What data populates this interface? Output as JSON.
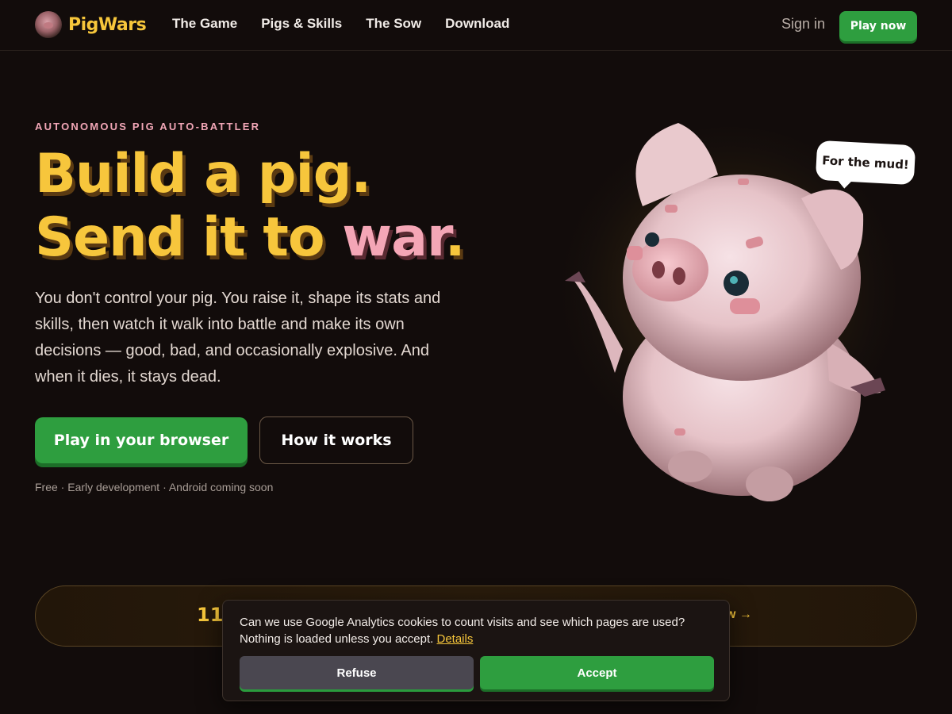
{
  "header": {
    "logo_text": "PigWars",
    "nav": [
      "The Game",
      "Pigs & Skills",
      "The Sow",
      "Download"
    ],
    "signin_label": "Sign in",
    "play_now_label": "Play now"
  },
  "hero": {
    "eyebrow": "AUTONOMOUS PIG AUTO-BATTLER",
    "headline_line1": "Build a pig.",
    "headline_line2_a": "Send it to ",
    "headline_line2_b": "war",
    "headline_line2_c": ".",
    "lead": "You don't control your pig. You raise it, shape its stats and skills, then watch it walk into battle and make its own decisions — good, bad, and occasionally explosive. And when it dies, it stays dead.",
    "primary_cta": "Play in your browser",
    "secondary_cta": "How it works",
    "fineprint": "Free · Early development · Android coming soon",
    "speech_bubble": "For the mud!"
  },
  "banner": {
    "number": "11",
    "link_text": "w →"
  },
  "cookie": {
    "message": "Can we use Google Analytics cookies to count visits and see which pages are used? Nothing is loaded unless you accept.",
    "details_link": "Details",
    "refuse_label": "Refuse",
    "accept_label": "Accept"
  },
  "colors": {
    "background": "#120c0b",
    "accent_yellow": "#f6c63b",
    "accent_pink": "#f4a6b6",
    "button_green": "#2e9e3f"
  }
}
